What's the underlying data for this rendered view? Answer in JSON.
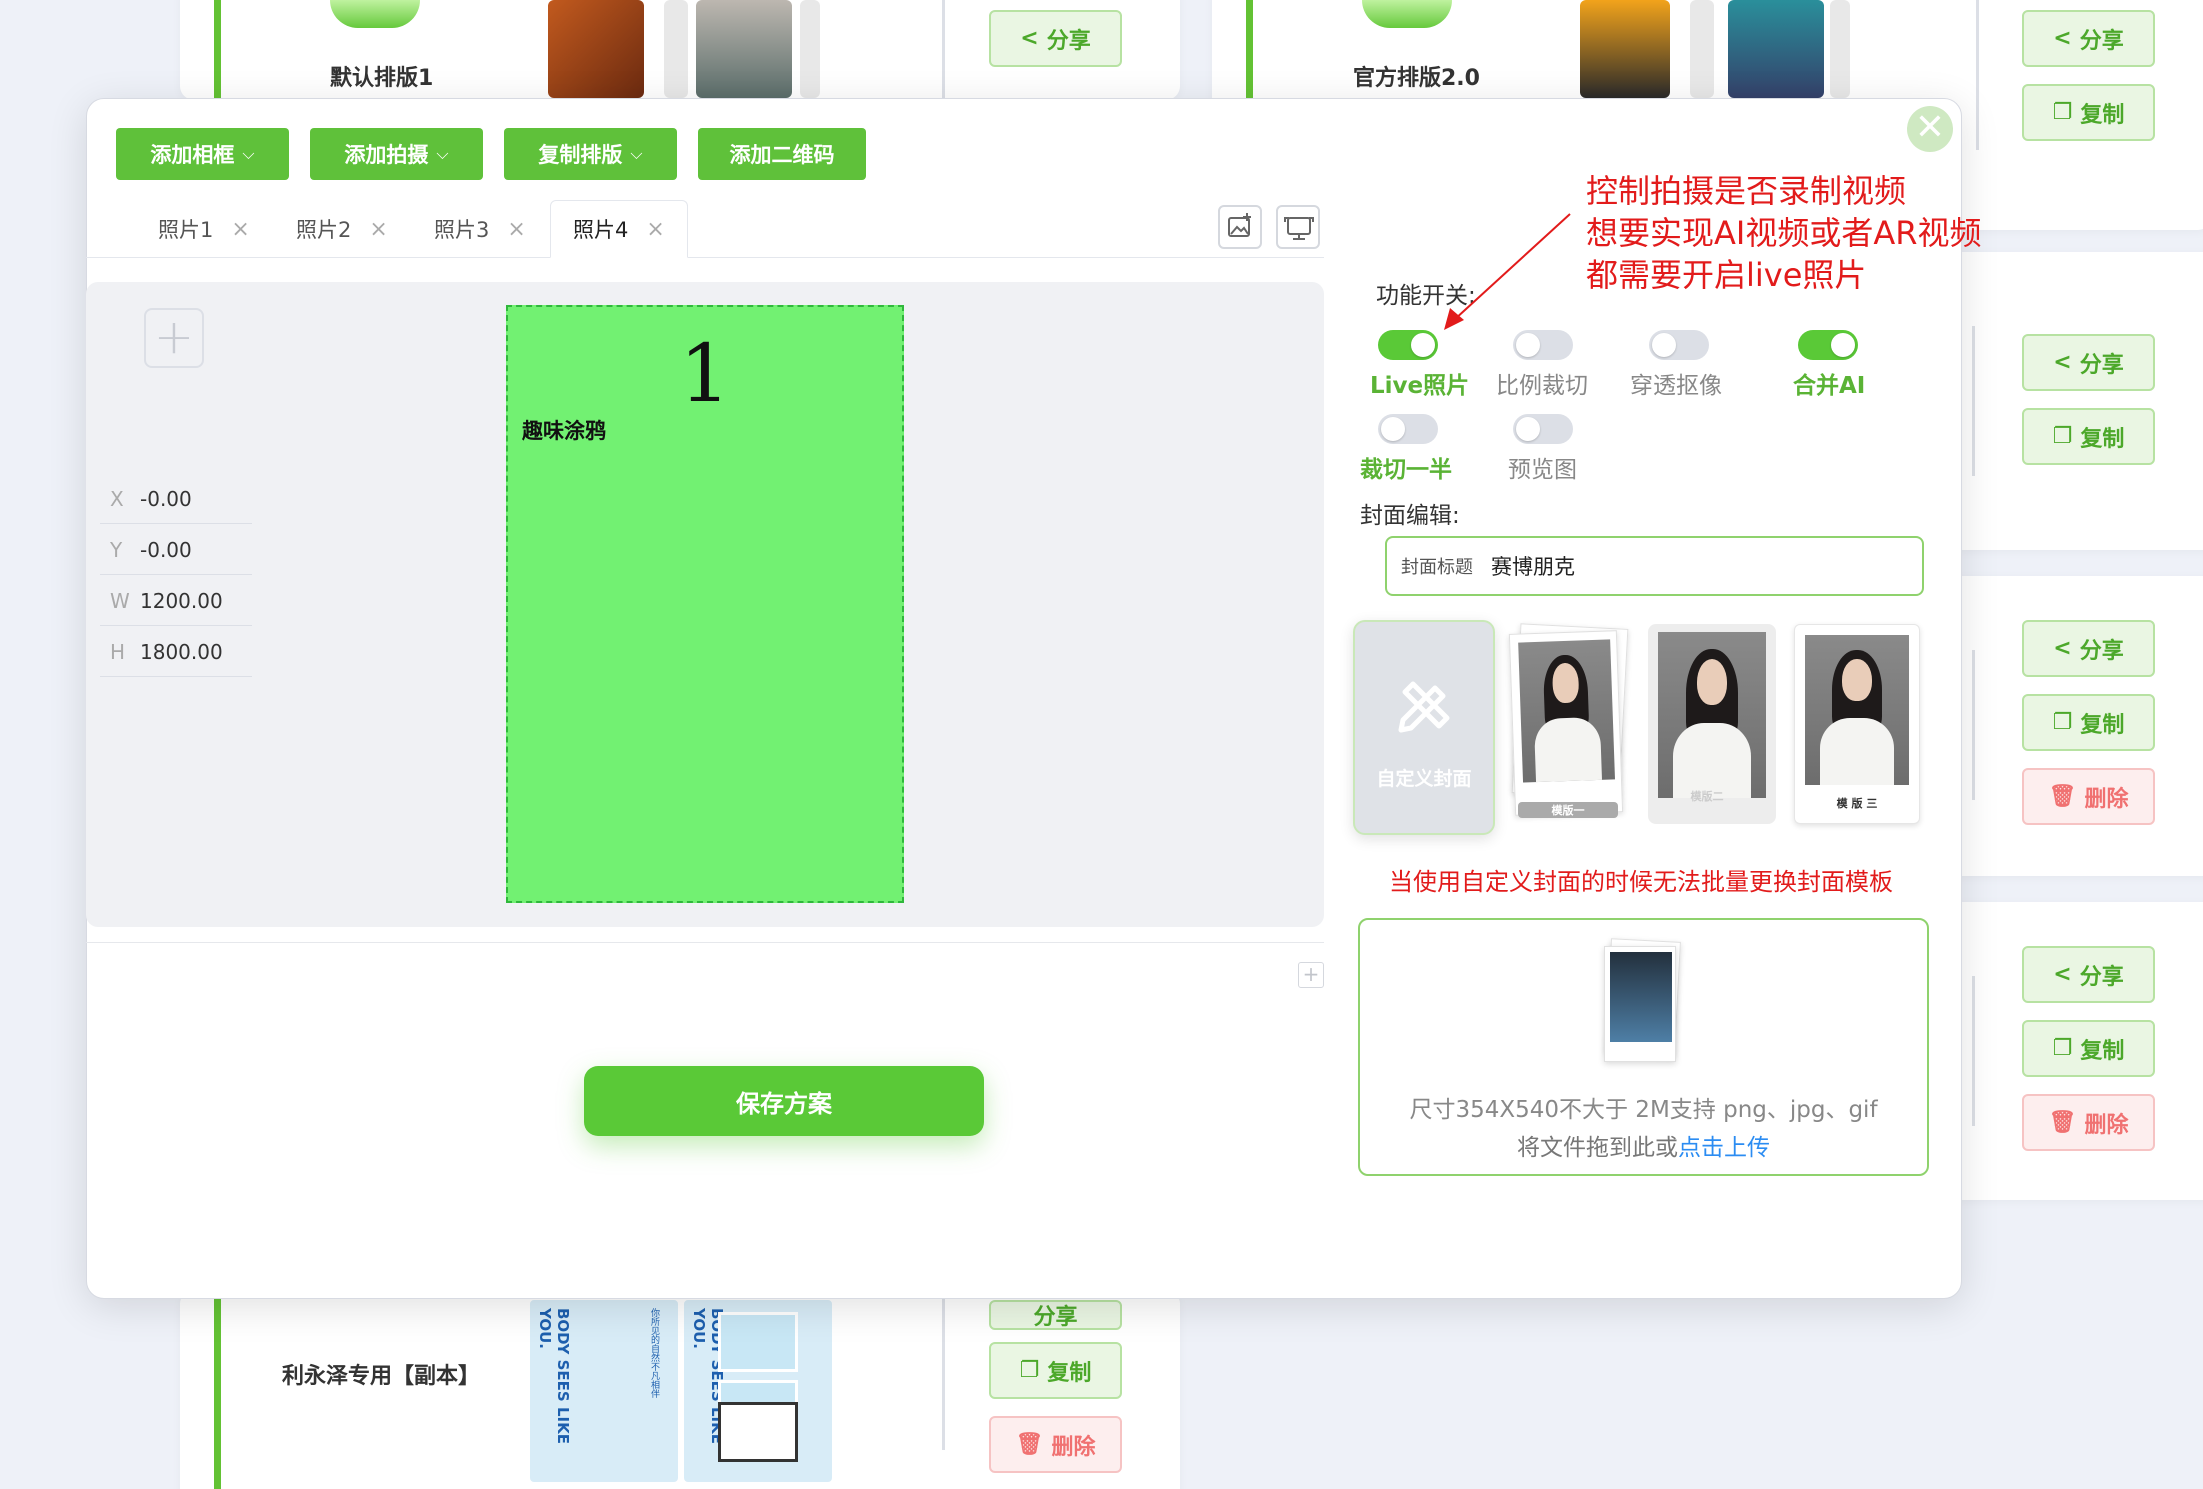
{
  "background": {
    "layouts": [
      {
        "name": "默认排版1"
      },
      {
        "name": "官方排版2.0"
      },
      {
        "name": "利永泽专用【副本】"
      }
    ],
    "buttons": {
      "share": "分享",
      "copy": "复制",
      "delete": "删除"
    },
    "poster_text": [
      "BODY SEES LIKE YOU.",
      "你所见的自然不凡相伴",
      "BODY SEES LIKE YOU.",
      "你所见的自然不凡相伴"
    ]
  },
  "toolbar": {
    "add_frame": "添加相框",
    "add_shoot": "添加拍摄",
    "copy_layout": "复制排版",
    "add_qrcode": "添加二维码"
  },
  "tabs": [
    {
      "label": "照片1"
    },
    {
      "label": "照片2"
    },
    {
      "label": "照片3"
    },
    {
      "label": "照片4",
      "active": true
    }
  ],
  "close_glyph": "✕",
  "plus_glyph": "+",
  "coords": [
    {
      "key": "X",
      "value": "-0.00"
    },
    {
      "key": "Y",
      "value": "-0.00"
    },
    {
      "key": "W",
      "value": "1200.00"
    },
    {
      "key": "H",
      "value": "1800.00"
    }
  ],
  "photo_frame": {
    "number": "1",
    "label": "趣味涂鸦",
    "color": "#72f172"
  },
  "save_button": "保存方案",
  "features": {
    "title": "功能开关:",
    "switches": [
      {
        "label": "Live照片",
        "on": true
      },
      {
        "label": "比例裁切",
        "on": false
      },
      {
        "label": "穿透抠像",
        "on": false
      },
      {
        "label": "合并AI",
        "on": true
      },
      {
        "label": "裁切一半",
        "on": false
      },
      {
        "label": "预览图",
        "on": false
      }
    ]
  },
  "cover": {
    "section_label": "封面编辑:",
    "title_key": "封面标题",
    "title_value": "赛博朋克",
    "custom_label": "自定义封面",
    "templates": [
      "模版一",
      "模版二",
      "模 版 三"
    ]
  },
  "upload": {
    "hint": "尺寸354X540不大于 2M支持 png、jpg、gif",
    "drag_text": "将文件拖到此或",
    "click_text": "点击上传"
  },
  "annotations": {
    "live_note": [
      "控制拍摄是否录制视频",
      "想要实现AI视频或者AR视频",
      "都需要开启live照片"
    ],
    "custom_cover_note": "当使用自定义封面的时候无法批量更换封面模板"
  },
  "colors": {
    "accent": "#5fc13a",
    "annotation": "#e21b1b",
    "link": "#2b8cf2"
  }
}
